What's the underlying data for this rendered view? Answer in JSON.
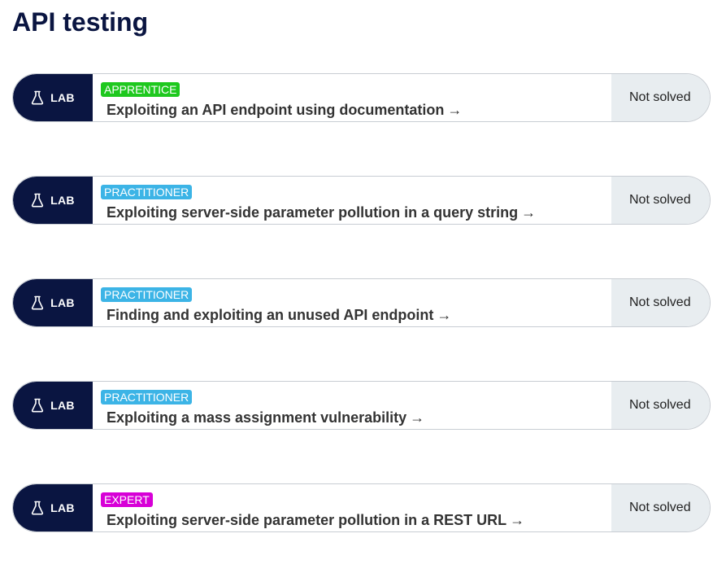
{
  "page": {
    "title": "API testing"
  },
  "colors": {
    "navy": "#0a1541",
    "apprentice": "#1ec81e",
    "practitioner": "#3cb4e6",
    "expert": "#d700d7",
    "status_bg": "#e8edf0"
  },
  "labs": [
    {
      "tag": "LAB",
      "icon": "flask-icon",
      "level": "APPRENTICE",
      "title": "Exploiting an API endpoint using documentation",
      "arrow": "→",
      "status": "Not solved"
    },
    {
      "tag": "LAB",
      "icon": "flask-icon",
      "level": "PRACTITIONER",
      "title": "Exploiting server-side parameter pollution in a query string",
      "arrow": "→",
      "status": "Not solved"
    },
    {
      "tag": "LAB",
      "icon": "flask-icon",
      "level": "PRACTITIONER",
      "title": "Finding and exploiting an unused API endpoint",
      "arrow": "→",
      "status": "Not solved"
    },
    {
      "tag": "LAB",
      "icon": "flask-icon",
      "level": "PRACTITIONER",
      "title": "Exploiting a mass assignment vulnerability",
      "arrow": "→",
      "status": "Not solved"
    },
    {
      "tag": "LAB",
      "icon": "flask-icon",
      "level": "EXPERT",
      "title": "Exploiting server-side parameter pollution in a REST URL",
      "arrow": "→",
      "status": "Not solved"
    }
  ]
}
